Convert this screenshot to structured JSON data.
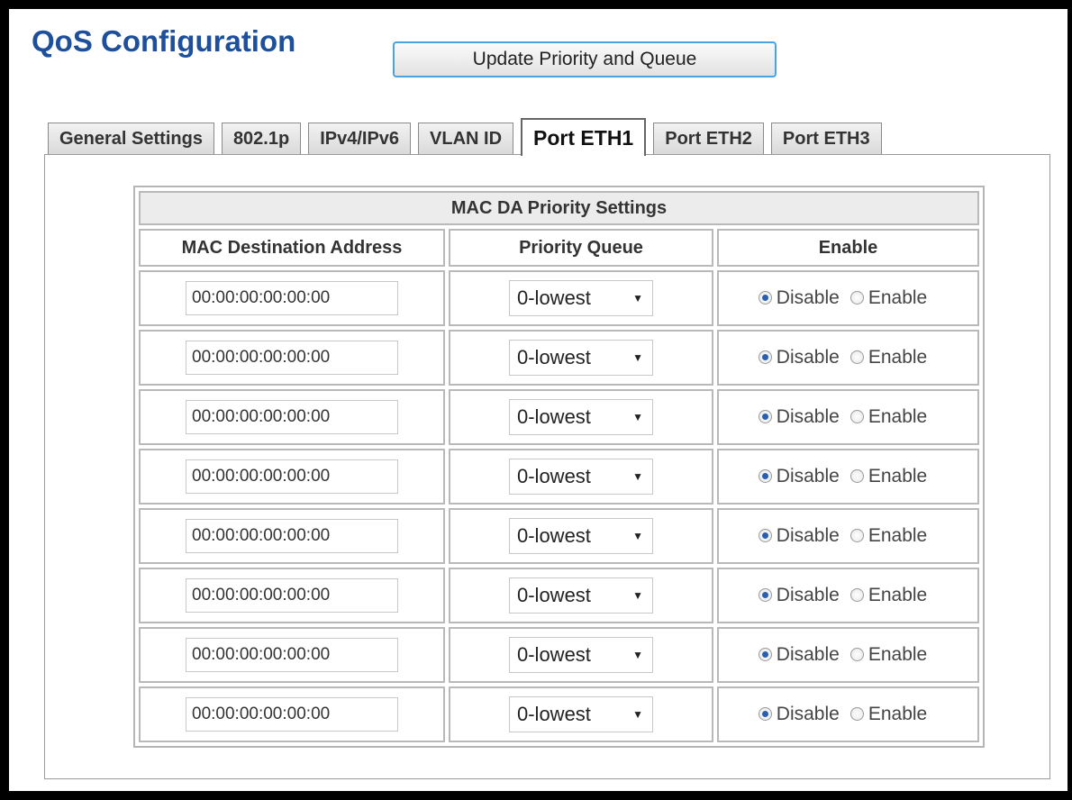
{
  "page": {
    "title": "QoS Configuration"
  },
  "toolbar": {
    "update_label": "Update Priority and Queue"
  },
  "tabs": [
    {
      "label": "General Settings",
      "active": false
    },
    {
      "label": "802.1p",
      "active": false
    },
    {
      "label": "IPv4/IPv6",
      "active": false
    },
    {
      "label": "VLAN ID",
      "active": false
    },
    {
      "label": "Port ETH1",
      "active": true
    },
    {
      "label": "Port ETH2",
      "active": false
    },
    {
      "label": "Port ETH3",
      "active": false
    }
  ],
  "table": {
    "caption": "MAC DA Priority Settings",
    "headers": {
      "mac": "MAC Destination Address",
      "queue": "Priority Queue",
      "enable": "Enable"
    },
    "disable_label": "Disable",
    "enable_label": "Enable",
    "rows": [
      {
        "mac": "00:00:00:00:00:00",
        "queue": "0-lowest",
        "state": "Disable"
      },
      {
        "mac": "00:00:00:00:00:00",
        "queue": "0-lowest",
        "state": "Disable"
      },
      {
        "mac": "00:00:00:00:00:00",
        "queue": "0-lowest",
        "state": "Disable"
      },
      {
        "mac": "00:00:00:00:00:00",
        "queue": "0-lowest",
        "state": "Disable"
      },
      {
        "mac": "00:00:00:00:00:00",
        "queue": "0-lowest",
        "state": "Disable"
      },
      {
        "mac": "00:00:00:00:00:00",
        "queue": "0-lowest",
        "state": "Disable"
      },
      {
        "mac": "00:00:00:00:00:00",
        "queue": "0-lowest",
        "state": "Disable"
      },
      {
        "mac": "00:00:00:00:00:00",
        "queue": "0-lowest",
        "state": "Disable"
      }
    ]
  },
  "colors": {
    "title": "#1d4f9a",
    "button_border": "#4aa3df",
    "radio_selected": "#2a5fb0"
  }
}
